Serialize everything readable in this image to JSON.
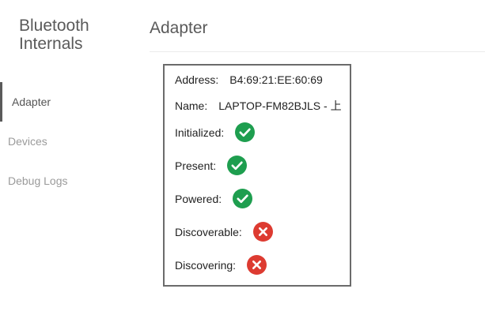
{
  "sidebar": {
    "title_line1": "Bluetooth",
    "title_line2": "Internals",
    "items": [
      {
        "label": "Adapter"
      },
      {
        "label": "Devices"
      },
      {
        "label": "Debug Logs"
      }
    ]
  },
  "main": {
    "title": "Adapter",
    "adapter": {
      "address_label": "Address:",
      "address_value": "B4:69:21:EE:60:69",
      "name_label": "Name:",
      "name_value": "LAPTOP-FM82BJLS - 上",
      "initialized_label": "Initialized:",
      "initialized_status": "check-icon",
      "present_label": "Present:",
      "present_status": "check-icon",
      "powered_label": "Powered:",
      "powered_status": "check-icon",
      "discoverable_label": "Discoverable:",
      "discoverable_status": "cross-icon",
      "discovering_label": "Discovering:",
      "discovering_status": "cross-icon"
    }
  },
  "colors": {
    "success": "#1e9e4f",
    "error": "#dd3b31",
    "text": "#222222",
    "muted": "#9a9a9a"
  }
}
